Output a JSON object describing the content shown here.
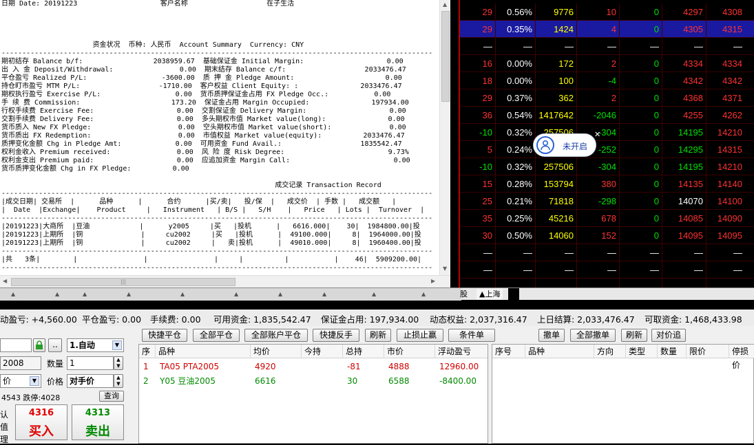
{
  "report": {
    "lines": [
      "日期 Date: 20191223                    客户名称                   在子生活",
      "",
      "",
      "",
      "",
      "                      资金状况  币种: 人民币  Account Summary  Currency: CNY",
      "--------------------------------------------------------------------------------------------------------",
      "期初结存 Balance b/f:                 2038959.67  基础保证金 Initial Margin:                    0.00",
      "出 入 金 Deposit/Withdrawal:                0.00  期末结存 Balance c/f:                   2033476.47",
      "平仓盈亏 Realized P/L:                  -3600.00  质 押 金 Pledge Amount:                      0.00",
      "持仓盯市盈亏 MTM P/L:                   -1710.00  客户权益 Client Equity: :               2033476.47",
      "期权执行盈亏 Exercise P/L:                  0.00  货币质押保证金占用 FX Pledge Occ.:           0.00",
      "手 续 费 Commission:                      173.20  保证金占用 Margin Occupied:               197934.00",
      "行权手续费 Exercise Fee:                    0.00  交割保证金 Delivery Margin:                    0.00",
      "交割手续费 Delivery Fee:                    0.00  多头期权市值 Market value(long):               0.00",
      "货币质入 New FX Pledge:                     0.00  空头期权市值 Market value(short):              0.00",
      "货币质出 FX Redemption:                     0.00  市值权益 Market value(equity):          2033476.47",
      "质押变化金额 Chg in Pledge Amt:             0.00  可用资金 Fund Avail.:                   1835542.47",
      "权利金收入 Premium received:                0.00  风 险 度 Risk Degree:                         9.73%",
      "权利金支出 Premium paid:                    0.00  应追加资金 Margin Call:                         0.00",
      "货币质押变化金额 Chg in FX Pledge:          0.00",
      "",
      "                                                                  成交记录 Transaction Record",
      "--------------------------------------------------------------------------------------------------------",
      "|成交日期| 交易所  |      品种      |      合约      |买/卖|   投/保  |   成交价  | 手数 |   成交额   |",
      "|  Date  |Exchange|    Product     |   Instrument   | B/S |   S/H    |   Price   | Lots |  Turnover  |",
      "--------------------------------------------------------------------------------------------------------",
      "|20191223|大商所  |豆油            |      y2005     |买   |投机      |   6616.000|    30|  1984800.00|投",
      "|20191223|上期所  |铜              |     cu2002     |买   |投机      |  49100.000|     8|  1964000.00|投",
      "|20191223|上期所  |铜              |     cu2002     |   卖|投机      |  49010.000|     8|  1960400.00|投",
      "--------------------------------------------------------------------------------------------------------",
      "|共   3条|        |                |                |     |          |           |    46|  5909200.00|",
      "--------------------------------------------------------------------------------------------------------"
    ]
  },
  "quotes": {
    "rows": [
      {
        "c1": "29",
        "c2": "0.56%",
        "c3": "9776",
        "c4": "10",
        "c5": "0",
        "c6": "4297",
        "c7": "4308",
        "c1c": "red",
        "c2c": "white",
        "c3c": "yellow",
        "c4c": "red",
        "c5c": "green",
        "c6c": "red",
        "c7c": "red"
      },
      {
        "c1": "29",
        "c2": "0.35%",
        "c3": "1424",
        "c4": "4",
        "c5": "0",
        "c6": "4305",
        "c7": "4315",
        "c1c": "red",
        "c2c": "white",
        "c3c": "yellow",
        "c4c": "red",
        "c5c": "green",
        "c6c": "red",
        "c7c": "red",
        "sel": true
      },
      {
        "c1": "—",
        "c2": "—",
        "c3": "—",
        "c4": "—",
        "c5": "—",
        "c6": "—",
        "c7": "—",
        "c1c": "white",
        "c2c": "white",
        "c3c": "white",
        "c4c": "white",
        "c5c": "white",
        "c6c": "white",
        "c7c": "white"
      },
      {
        "c1": "16",
        "c2": "0.00%",
        "c3": "172",
        "c4": "2",
        "c5": "0",
        "c6": "4334",
        "c7": "4334",
        "c1c": "red",
        "c2c": "white",
        "c3c": "yellow",
        "c4c": "red",
        "c5c": "green",
        "c6c": "red",
        "c7c": "red"
      },
      {
        "c1": "18",
        "c2": "0.00%",
        "c3": "100",
        "c4": "-4",
        "c5": "0",
        "c6": "4342",
        "c7": "4342",
        "c1c": "red",
        "c2c": "white",
        "c3c": "yellow",
        "c4c": "green",
        "c5c": "green",
        "c6c": "red",
        "c7c": "red"
      },
      {
        "c1": "29",
        "c2": "0.37%",
        "c3": "362",
        "c4": "2",
        "c5": "0",
        "c6": "4368",
        "c7": "4371",
        "c1c": "red",
        "c2c": "white",
        "c3c": "yellow",
        "c4c": "red",
        "c5c": "green",
        "c6c": "red",
        "c7c": "red"
      },
      {
        "c1": "36",
        "c2": "0.54%",
        "c3": "1417642",
        "c4": "-2046",
        "c5": "0",
        "c6": "4255",
        "c7": "4262",
        "c1c": "red",
        "c2c": "white",
        "c3c": "yellow",
        "c4c": "green",
        "c5c": "green",
        "c6c": "red",
        "c7c": "red"
      },
      {
        "c1": "-10",
        "c2": "0.32%",
        "c3": "257506",
        "c4": "-304",
        "c5": "0",
        "c6": "14195",
        "c7": "14210",
        "c1c": "green",
        "c2c": "white",
        "c3c": "yellow",
        "c4c": "green",
        "c5c": "green",
        "c6c": "green",
        "c7c": "red"
      },
      {
        "c1": "5",
        "c2": "0.24%",
        "c3": "",
        "c4": "-252",
        "c5": "0",
        "c6": "14295",
        "c7": "14315",
        "c1c": "red",
        "c2c": "white",
        "c3c": "yellow",
        "c4c": "green",
        "c5c": "green",
        "c6c": "green",
        "c7c": "red"
      },
      {
        "c1": "-10",
        "c2": "0.32%",
        "c3": "257506",
        "c4": "-304",
        "c5": "0",
        "c6": "14195",
        "c7": "14210",
        "c1c": "green",
        "c2c": "white",
        "c3c": "yellow",
        "c4c": "green",
        "c5c": "green",
        "c6c": "green",
        "c7c": "red"
      },
      {
        "c1": "15",
        "c2": "0.28%",
        "c3": "153794",
        "c4": "380",
        "c5": "0",
        "c6": "14135",
        "c7": "14140",
        "c1c": "red",
        "c2c": "white",
        "c3c": "yellow",
        "c4c": "red",
        "c5c": "green",
        "c6c": "red",
        "c7c": "red"
      },
      {
        "c1": "25",
        "c2": "0.21%",
        "c3": "71818",
        "c4": "-298",
        "c5": "0",
        "c6": "14070",
        "c7": "14100",
        "c1c": "red",
        "c2c": "white",
        "c3c": "yellow",
        "c4c": "green",
        "c5c": "green",
        "c6c": "white",
        "c7c": "red"
      },
      {
        "c1": "35",
        "c2": "0.25%",
        "c3": "45216",
        "c4": "678",
        "c5": "0",
        "c6": "14085",
        "c7": "14090",
        "c1c": "red",
        "c2c": "white",
        "c3c": "yellow",
        "c4c": "red",
        "c5c": "green",
        "c6c": "red",
        "c7c": "red"
      },
      {
        "c1": "30",
        "c2": "0.50%",
        "c3": "14060",
        "c4": "152",
        "c5": "0",
        "c6": "14095",
        "c7": "14095",
        "c1c": "red",
        "c2c": "white",
        "c3c": "yellow",
        "c4c": "red",
        "c5c": "green",
        "c6c": "red",
        "c7c": "red"
      },
      {
        "c1": "—",
        "c2": "—",
        "c3": "—",
        "c4": "—",
        "c5": "—",
        "c6": "—",
        "c7": "—",
        "c1c": "white",
        "c2c": "white",
        "c3c": "white",
        "c4c": "white",
        "c5c": "white",
        "c6c": "white",
        "c7c": "white"
      },
      {
        "c1": "—",
        "c2": "—",
        "c3": "—",
        "c4": "—",
        "c5": "—",
        "c6": "—",
        "c7": "—",
        "c1c": "white",
        "c2c": "white",
        "c3c": "white",
        "c4c": "white",
        "c5c": "white",
        "c6c": "white",
        "c7c": "white"
      },
      {
        "c1": "—",
        "c2": "—",
        "c3": "—",
        "c4": "—",
        "c5": "—",
        "c6": "—",
        "c7": "—",
        "c1c": "white",
        "c2c": "white",
        "c3c": "white",
        "c4c": "white",
        "c5c": "white",
        "c6c": "white",
        "c7c": "white"
      }
    ]
  },
  "badge": {
    "label": "未开启"
  },
  "tabbar": {
    "tab1": "股",
    "tab2": "▲上海"
  },
  "summary": {
    "float_pl": "动盈亏: +4,560.00",
    "close_pl": "平仓盈亏: 0.00",
    "fee": "手续费: 0.00",
    "avail": "可用资金: 1,835,542.47",
    "margin": "保证金占用: 197,934.00",
    "equity": "动态权益: 2,037,316.47",
    "settle": "上日结算: 2,033,476.47",
    "withdraw": "可取资金: 1,468,433.98"
  },
  "order": {
    "auto_select": "1.自动",
    "dots": "..",
    "contract_value": "2008",
    "qty_label": "数量",
    "qty_value": "1",
    "price_type": "价",
    "price_label": "价格",
    "price_value": "对手价",
    "limits": "4543 跌停:4028",
    "view_btn": "查询",
    "side_labels": [
      "认",
      "值",
      "理"
    ],
    "buy_price": "4316",
    "buy_label": "买入",
    "sell_price": "4313",
    "sell_label": "卖出"
  },
  "toolbar": {
    "quick_close": "快捷平仓",
    "close_all": "全部平仓",
    "close_all_accounts": "全部账户平仓",
    "quick_reverse": "快捷反手",
    "refresh": "刷新",
    "stop": "止损止赢",
    "cond": "条件单",
    "cancel": "撤单",
    "cancel_all": "全部撤单",
    "refresh2": "刷新",
    "price_chase": "对价追"
  },
  "positions": {
    "headers": [
      "序",
      "品种",
      "均价",
      "今持",
      "总持",
      "市价",
      "浮动盈亏"
    ],
    "rows": [
      {
        "no": "1",
        "name": "TA05 PTA2005",
        "avg": "4920",
        "today": "",
        "total": "-81",
        "mkt": "4888",
        "pl": "12960.00"
      },
      {
        "no": "2",
        "name": "Y05 豆油2005",
        "avg": "6616",
        "today": "",
        "total": "30",
        "mkt": "6588",
        "pl": "-8400.00"
      }
    ]
  },
  "orders": {
    "headers": [
      "序号",
      "品种",
      "方向",
      "类型",
      "数量",
      "限价",
      "停损价"
    ]
  }
}
